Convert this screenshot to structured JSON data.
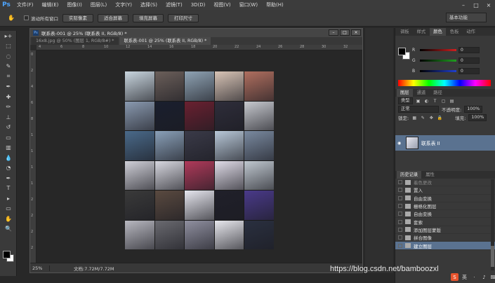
{
  "app": {
    "logo": "Ps"
  },
  "menu": [
    "文件(F)",
    "编辑(E)",
    "图像(I)",
    "图层(L)",
    "文字(Y)",
    "选择(S)",
    "滤镜(T)",
    "3D(D)",
    "视图(V)",
    "窗口(W)",
    "帮助(H)"
  ],
  "window_controls": [
    "–",
    "□",
    "×"
  ],
  "options": {
    "scroll_all": "滚动所有窗口",
    "buttons": [
      "实际像素",
      "适合屏幕",
      "填充屏幕",
      "打印尺寸"
    ],
    "workspace": "基本功能"
  },
  "document": {
    "title": "联系表-001 @ 25% (联系表 II, RGB/8) *",
    "tabs": [
      {
        "label": "16x8.jpg @ 50% (图层 1, RGB/8#) *",
        "active": false
      },
      {
        "label": "联系表-001 @ 25% (联系表 II, RGB/8) *",
        "active": true
      }
    ],
    "zoom": "25%",
    "status": "文档:7.72M/7.72M",
    "ruler_h": [
      "4",
      "6",
      "8",
      "10",
      "12",
      "14",
      "16",
      "18",
      "20",
      "22",
      "24",
      "26",
      "28",
      "30",
      "32"
    ],
    "ruler_v": [
      "0",
      "2",
      "4",
      "6",
      "8",
      "1",
      "1",
      "1",
      "1",
      "2",
      "2",
      "2",
      "2"
    ]
  },
  "collage": {
    "cells": [
      "#c9d6df",
      "#6b5f5a",
      "#8fa3b4",
      "#d8c4b6",
      "#b06f5f",
      "#8a9ab0",
      "#1a1f2e",
      "#6a2030",
      "#2e2d3a",
      "#c7c9cf",
      "#4a6a8a",
      "#8aa0b8",
      "#3a3a48",
      "#b8c8d8",
      "#7a8aa0",
      "#d0d0d8",
      "#d8d8e0",
      "#b03a5a",
      "#e0dce8",
      "#c0c8d0",
      "#3a3a3a",
      "#5a4a40",
      "#e6e6ee",
      "#20202a",
      "#4a3a8a",
      "#b8b8c0",
      "#6a6a70",
      "#9090a0",
      "#e8e8ee",
      "#2a3040"
    ]
  },
  "color_panel": {
    "tabs": [
      "调板",
      "样式",
      "颜色",
      "色板",
      "动作"
    ],
    "active_tab": 2,
    "sliders": [
      {
        "label": "R",
        "value": "0",
        "color": "#d02020"
      },
      {
        "label": "G",
        "value": "0",
        "color": "#20a020"
      },
      {
        "label": "B",
        "value": "0",
        "color": "#2040d0"
      }
    ]
  },
  "layers_panel": {
    "tabs": [
      "图层",
      "通道",
      "路径"
    ],
    "active_tab": 0,
    "kind": "类型",
    "blend": "正常",
    "opacity_label": "不透明度:",
    "opacity": "100%",
    "lock_label": "锁定:",
    "fill_label": "填充:",
    "fill": "100%",
    "layer_name": "联系表 II"
  },
  "history_panel": {
    "tabs": [
      "历史记录",
      "属性"
    ],
    "active_tab": 0,
    "items": [
      {
        "label": "着色更改",
        "state": "faded"
      },
      {
        "label": "置入",
        "state": "normal"
      },
      {
        "label": "自由变换",
        "state": "normal"
      },
      {
        "label": "栅格化图层",
        "state": "normal"
      },
      {
        "label": "自由变换",
        "state": "normal"
      },
      {
        "label": "套索",
        "state": "normal"
      },
      {
        "label": "添加图层蒙版",
        "state": "normal"
      },
      {
        "label": "拼合图像",
        "state": "normal"
      },
      {
        "label": "建立图层",
        "state": "active"
      }
    ]
  },
  "watermark": "https://blog.csdn.net/bamboozxl",
  "ime": [
    "S",
    "英",
    "·",
    "♪",
    "⌨"
  ]
}
